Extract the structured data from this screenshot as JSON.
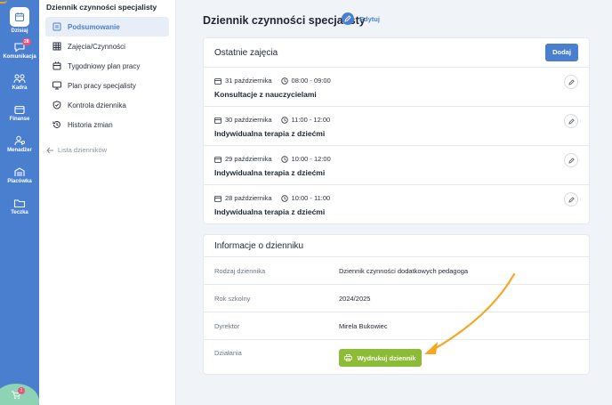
{
  "rail": {
    "items": [
      {
        "label": "Dzisiaj",
        "icon": "calendar-icon"
      },
      {
        "label": "Komunikacja",
        "icon": "chat-icon",
        "badge": "28"
      },
      {
        "label": "Kadra",
        "icon": "people-icon"
      },
      {
        "label": "Finanse",
        "icon": "wallet-icon"
      },
      {
        "label": "Menadżer",
        "icon": "manager-icon"
      },
      {
        "label": "Placówka",
        "icon": "building-icon"
      },
      {
        "label": "Teczka",
        "icon": "folder-icon"
      }
    ],
    "cart_badge": "1"
  },
  "sidebar": {
    "title": "Dziennik czynności specjalisty",
    "items": [
      {
        "label": "Podsumowanie",
        "icon": "summary-icon"
      },
      {
        "label": "Zajęcia/Czynności",
        "icon": "grid-icon"
      },
      {
        "label": "Tygodniowy plan pracy",
        "icon": "calendar-icon"
      },
      {
        "label": "Plan pracy specjalisty",
        "icon": "monitor-icon"
      },
      {
        "label": "Kontrola dziennika",
        "icon": "shield-check-icon"
      },
      {
        "label": "Historia zmian",
        "icon": "history-icon"
      }
    ],
    "back_link": "Lista dzienników"
  },
  "main": {
    "title": "Dziennik czynności specjalisty",
    "edit_label": "Edytuj",
    "recent": {
      "heading": "Ostatnie zajęcia",
      "add_label": "Dodaj",
      "sessions": [
        {
          "date": "31 października",
          "time": "08:00 - 09:00",
          "title": "Konsultacje z nauczycielami"
        },
        {
          "date": "30 października",
          "time": "11:00 - 12:00",
          "title": "Indywidualna terapia z dziećmi"
        },
        {
          "date": "29 października",
          "time": "10:00 - 12:00",
          "title": "Indywidualna terapia z dziećmi"
        },
        {
          "date": "28 października",
          "time": "10:00 - 11:00",
          "title": "Indywidualna terapia z dziećmi"
        }
      ]
    },
    "info": {
      "heading": "Informacje o dzienniku",
      "rows": [
        {
          "label": "Rodzaj dziennika",
          "value": "Dziennik czynności dodatkowych pedagoga"
        },
        {
          "label": "Rok szkolny",
          "value": "2024/2025"
        },
        {
          "label": "Dyrektor",
          "value": "Mirela Bukowiec"
        },
        {
          "label": "Działania",
          "value": ""
        }
      ],
      "print_label": "Wydrukuj dziennik"
    }
  },
  "colors": {
    "accent": "#4a7fd0",
    "print": "#8cbb35",
    "arrow": "#f5a623"
  }
}
